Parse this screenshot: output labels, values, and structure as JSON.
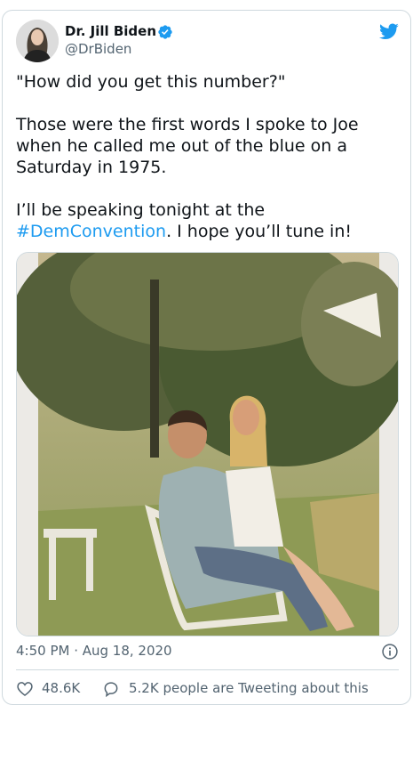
{
  "tweet": {
    "author_name": "Dr. Jill Biden",
    "author_handle": "@DrBiden",
    "text_line1": "\"How did you get this number?\"",
    "text_line2": "Those were the first words I spoke to Joe when he called me out of the blue on a Saturday in 1975.",
    "text_line3_before": "I’ll be speaking tonight at the ",
    "hashtag": "#DemConvention",
    "text_line3_after": ". I hope you’ll tune in!",
    "timestamp": "4:50 PM · Aug 18, 2020",
    "likes": "48.6K",
    "replies_text": "5.2K people are Tweeting about this"
  },
  "icons": {
    "verified": "verified-badge-icon",
    "brand": "twitter-bird-icon",
    "info": "info-icon",
    "like": "heart-icon",
    "reply": "speech-bubble-icon"
  },
  "colors": {
    "link": "#1d9bf0",
    "verified": "#1d9bf0",
    "secondary_text": "#536471",
    "border": "#cfd9de"
  }
}
